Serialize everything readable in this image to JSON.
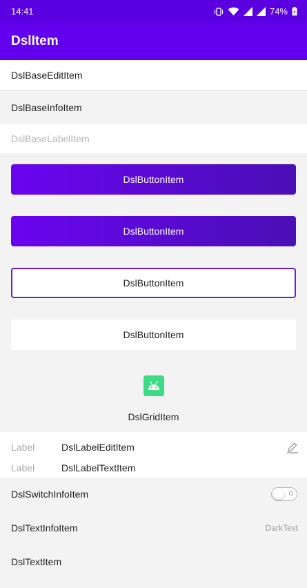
{
  "status_bar": {
    "time": "14:41",
    "battery": "74%"
  },
  "app_bar": {
    "title": "DslItem"
  },
  "items": {
    "base_edit": "DslBaseEditItem",
    "base_info": "DslBaseInfoItem",
    "base_label": "DslBaseLabelItem",
    "buttons": [
      "DslButtonItem",
      "DslButtonItem",
      "DslButtonItem",
      "DslButtonItem"
    ],
    "grid": {
      "label": "DslGridItem",
      "icon": "android-icon"
    },
    "label_edit": {
      "key": "Label",
      "value": "DslLabelEditItem",
      "icon": "pencil-icon"
    },
    "label_text": {
      "key": "Label",
      "value": "DslLabelTextItem"
    },
    "switch_info": {
      "label": "DslSwitchInfoItem",
      "checked": false
    },
    "text_info": {
      "label": "DslTextInfoItem",
      "right_text": "DarkText"
    },
    "text_item": "DslTextItem"
  },
  "colors": {
    "status_bar": "#5a00e0",
    "app_bar": "#6200ee",
    "accent": "#6a16e8",
    "android_green": "#3ddc84"
  }
}
